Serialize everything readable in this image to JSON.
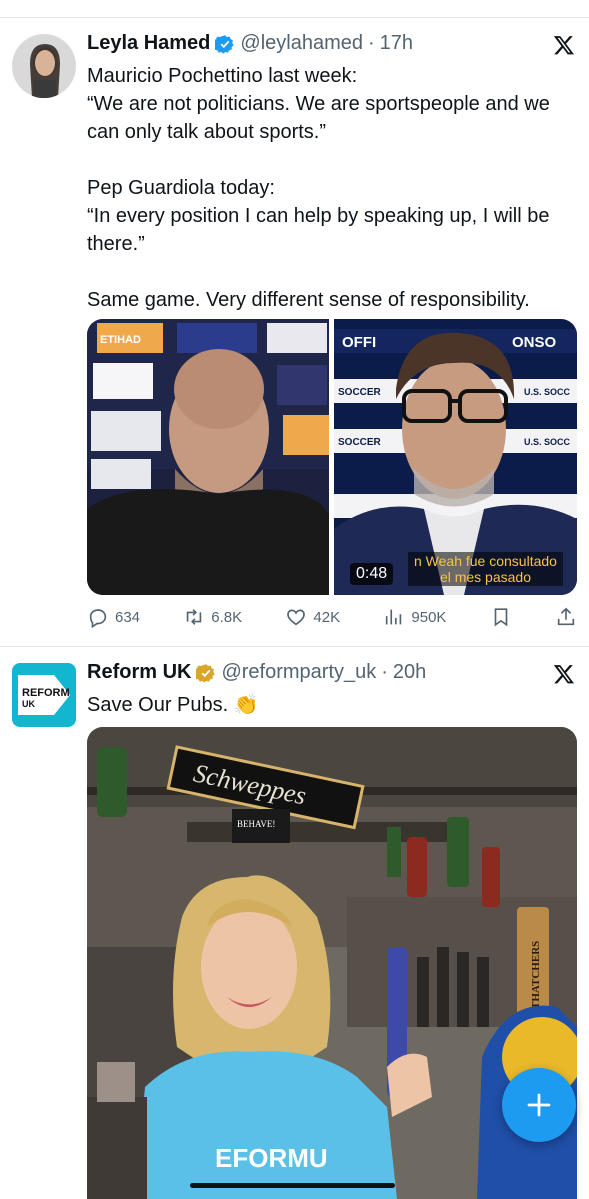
{
  "tweets": [
    {
      "author": "Leyla Hamed",
      "handle": "@leylahamed",
      "dot": "·",
      "time": "17h",
      "text_lines": [
        "Mauricio Pochettino last week:",
        "“We are not politicians. We are sportspeople and we can only talk about sports.”",
        "",
        "Pep Guardiola today:",
        "“In every position I can help by speaking up, I will be there.”",
        "",
        "Same game. Very different sense of responsibility."
      ],
      "video_duration": "0:48",
      "video_caption_1": "n Weah fue consultado",
      "video_caption_2": "el mes pasado",
      "press_board_1": "OFFI",
      "press_board_2": "ONSO",
      "press_soccer": "SOCCER",
      "press_us_soccer": "U.S. SOCC",
      "etihad": "ETIHAD",
      "stats": {
        "replies": "634",
        "reposts": "6.8K",
        "likes": "42K",
        "views": "950K"
      }
    },
    {
      "author": "Reform UK",
      "handle": "@reformparty_uk",
      "dot": "·",
      "time": "20h",
      "text": "Save Our Pubs. 👏",
      "logo_line1": "REFORM",
      "logo_line2": "UK",
      "sign_text": "Schweppes",
      "shirt_text": "EFORMU",
      "small_sign": "BEHAVE!",
      "tap_label": "THATCHERS"
    }
  ],
  "colors": {
    "accent": "#1d9bf0",
    "verified": "#1d9bf0",
    "reform_blue": "#12b6cf",
    "gold_badge": "#d9a52b"
  },
  "icons": [
    "verified-badge-icon",
    "x-logo-icon",
    "reply-icon",
    "repost-icon",
    "like-icon",
    "views-icon",
    "bookmark-icon",
    "share-icon",
    "plus-icon"
  ]
}
